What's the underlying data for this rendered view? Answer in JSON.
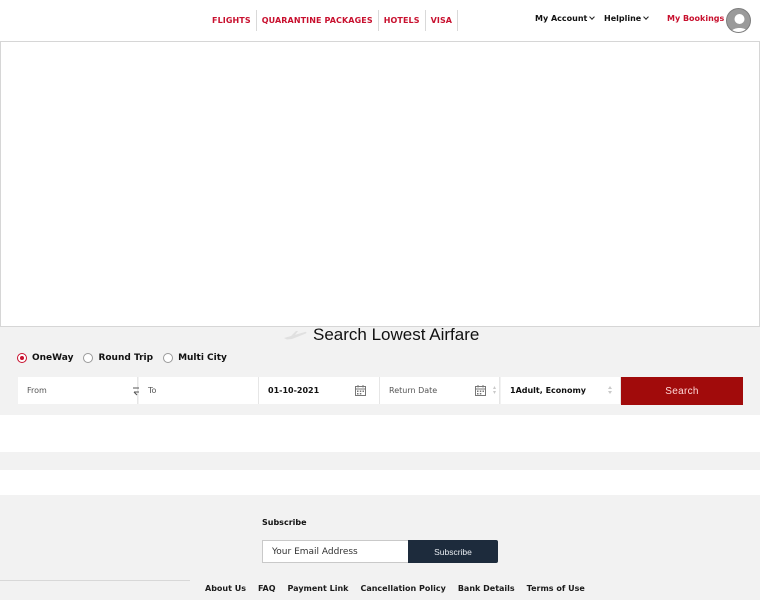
{
  "header": {
    "nav": [
      "FLIGHTS",
      "QUARANTINE PACKAGES",
      "HOTELS",
      "VISA"
    ],
    "my_account": "My Account",
    "helpline": "Helpline",
    "my_bookings": "My Bookings"
  },
  "search": {
    "title": "Search Lowest Airfare",
    "trip_types": [
      "OneWay",
      "Round Trip",
      "Multi City"
    ],
    "selected_trip": "OneWay",
    "from_placeholder": "From",
    "to_placeholder": "To",
    "depart_date": "01-10-2021",
    "return_placeholder": "Return Date",
    "passengers": "1Adult, Economy",
    "search_button": "Search"
  },
  "footer": {
    "subscribe_label": "Subscribe",
    "email_placeholder": "Your Email Address",
    "subscribe_button": "Subscribe",
    "links": [
      "About Us",
      "FAQ",
      "Payment Link",
      "Cancellation Policy",
      "Bank Details",
      "Terms of Use"
    ]
  },
  "colors": {
    "brand_red": "#c8102e",
    "search_button": "#a10b0b",
    "subscribe_button": "#1d2b3c",
    "section_bg": "#f2f2f2"
  },
  "icons": {
    "plane": "plane-icon",
    "swap": "swap-icon",
    "calendar": "calendar-icon",
    "avatar": "user-avatar-icon"
  }
}
